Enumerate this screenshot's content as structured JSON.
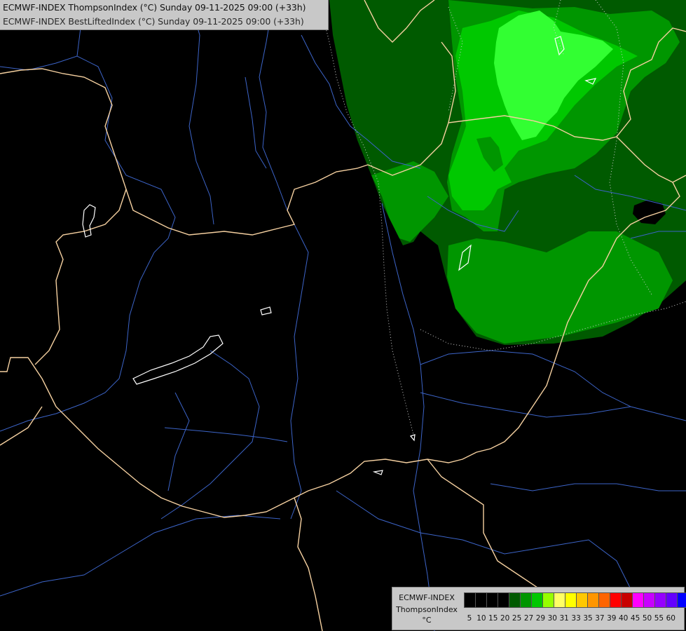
{
  "header": {
    "line1": "ECMWF-INDEX ThompsonIndex (°C) Sunday 09-11-2025 09:00 (+33h)",
    "line2": "ECMWF-INDEX BestLiftedIndex (°C) Sunday 09-11-2025 09:00 (+33h)"
  },
  "legend": {
    "model": "ECMWF-INDEX",
    "parameter": "ThompsonIndex",
    "unit": "°C",
    "ticks": [
      "5",
      "10",
      "15",
      "20",
      "25",
      "27",
      "29",
      "30",
      "31",
      "33",
      "35",
      "37",
      "39",
      "40",
      "45",
      "50",
      "55",
      "60"
    ],
    "colors": [
      "#000000",
      "#000000",
      "#000000",
      "#000000",
      "#005a00",
      "#009600",
      "#00c800",
      "#96ff00",
      "#ffff64",
      "#ffff00",
      "#ffc800",
      "#ff9600",
      "#ff6400",
      "#ff0000",
      "#c80000",
      "#ff00ff",
      "#c800ff",
      "#9600ff",
      "#6400ff",
      "#0000ff"
    ]
  },
  "map": {
    "shading_colors": {
      "outer": "#005a00",
      "middle": "#009600",
      "inner": "#00c800",
      "core": "#32ff32"
    },
    "border_color": "#f5d0a0",
    "river_color": "#3c64c8",
    "contour_color": "#cccccc"
  }
}
